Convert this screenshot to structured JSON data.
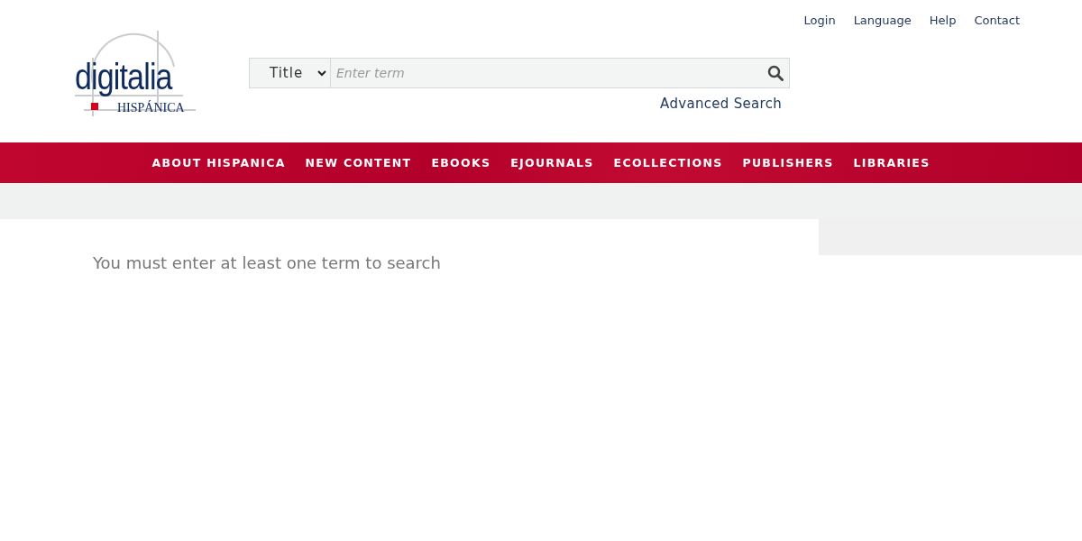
{
  "top_links": [
    "Login",
    "Language",
    "Help",
    "Contact"
  ],
  "logo": {
    "wordmark": "digitalia",
    "subtitle": "HISPÁNICA"
  },
  "search": {
    "field_select": "Title",
    "placeholder": "Enter term",
    "advanced_link": "Advanced Search"
  },
  "nav": [
    "ABOUT HISPANICA",
    "NEW CONTENT",
    "EBOOKS",
    "EJOURNALS",
    "ECOLLECTIONS",
    "PUBLISHERS",
    "LIBRARIES"
  ],
  "message": "You must enter at least one term to search"
}
